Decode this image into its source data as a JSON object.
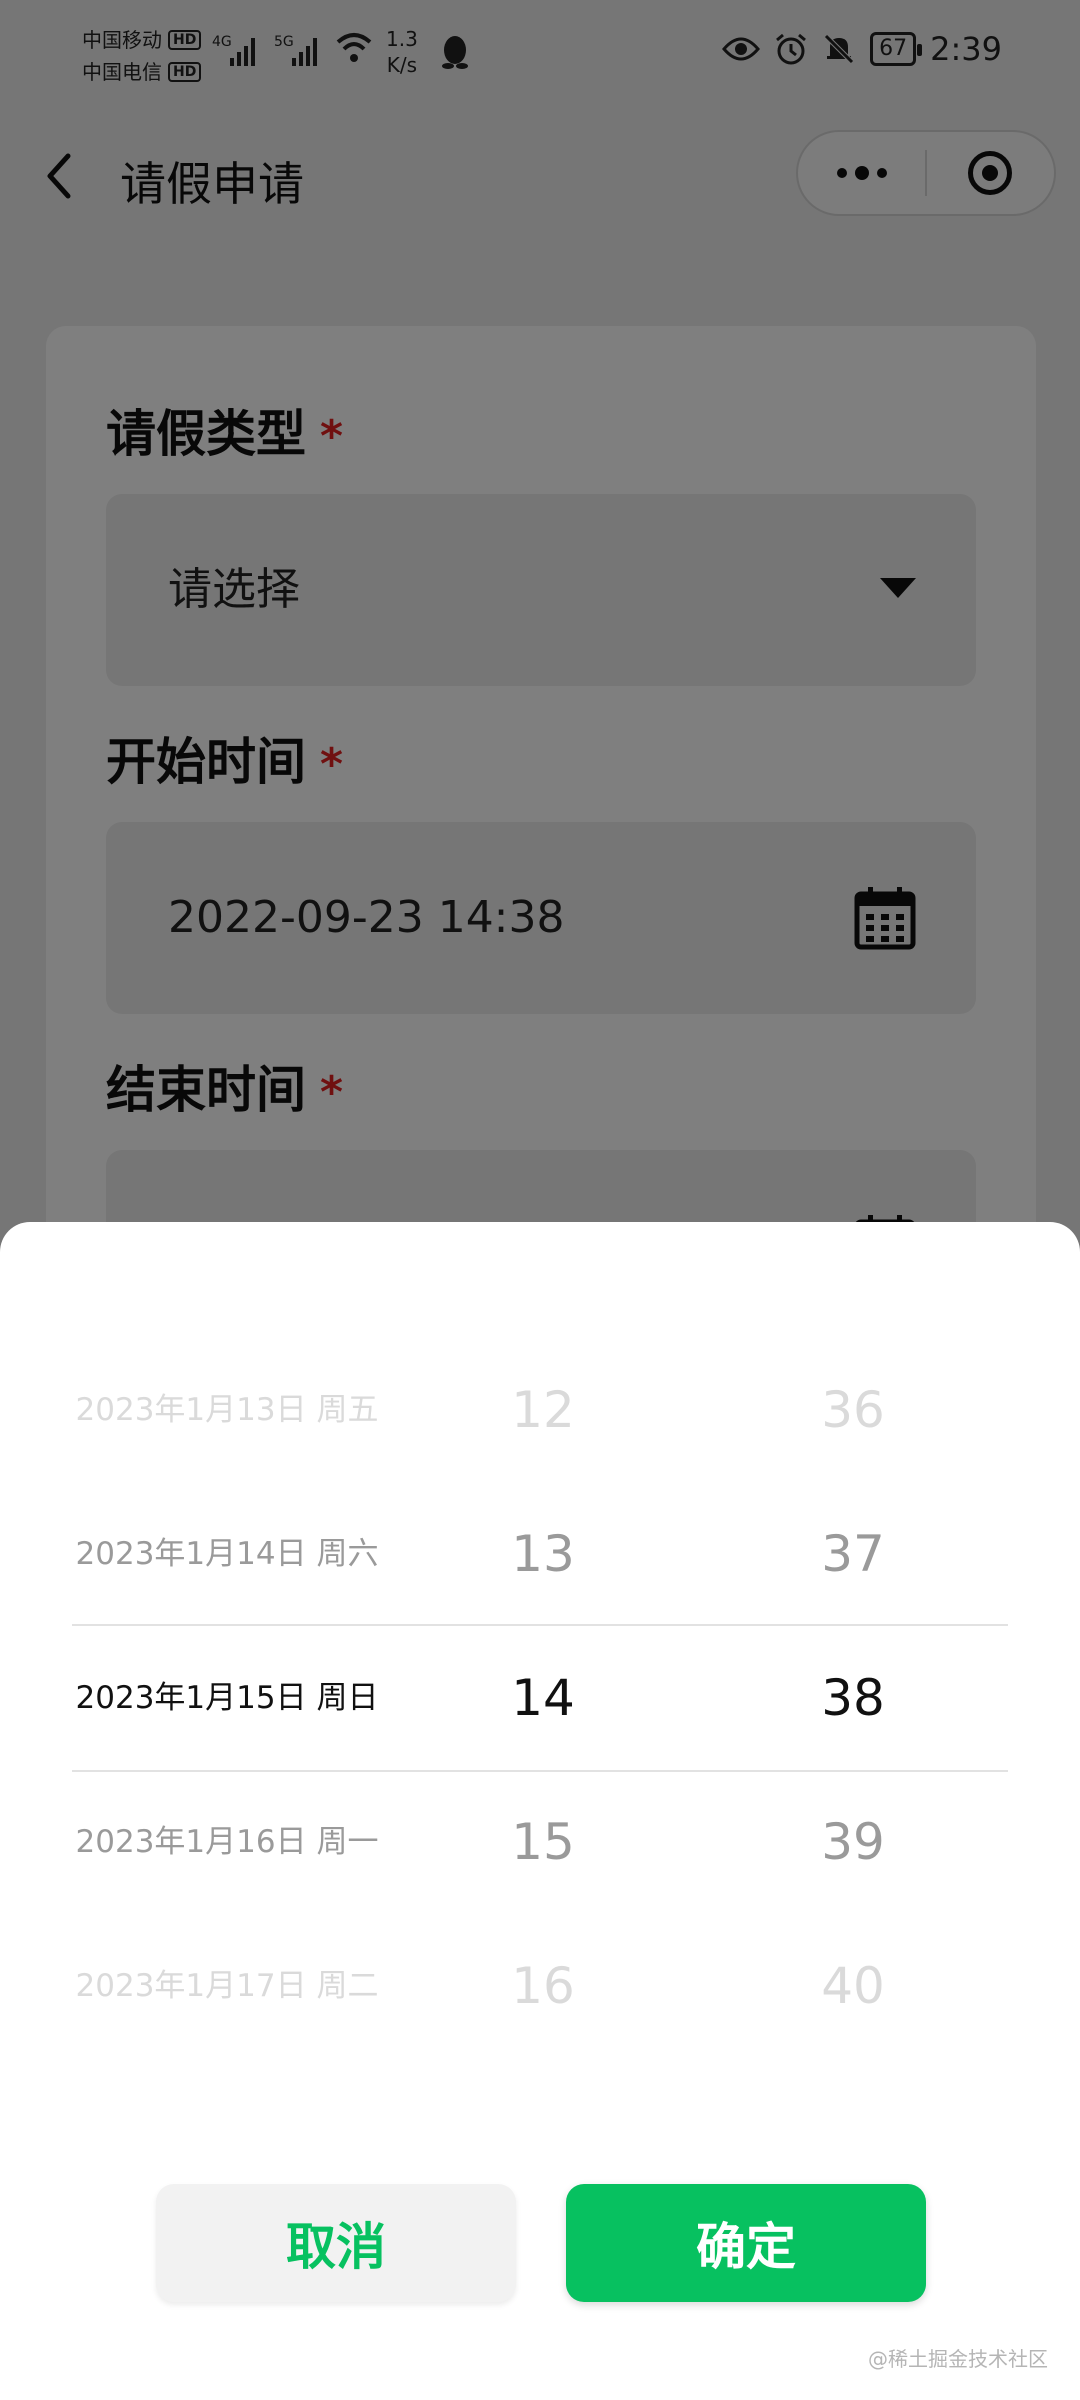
{
  "status_bar": {
    "carrier_1": "中国移动",
    "carrier_2": "中国电信",
    "hd": "HD",
    "net_1": "4G",
    "net_2": "5G",
    "speed_value": "1.3",
    "speed_unit": "K/s",
    "battery": "67",
    "time": "2:39"
  },
  "nav": {
    "title": "请假申请"
  },
  "form": {
    "leave_type_label": "请假类型",
    "leave_type_placeholder": "请选择",
    "start_label": "开始时间",
    "start_value": "2022-09-23 14:38",
    "end_label": "结束时间",
    "required_mark": "*"
  },
  "picker": {
    "rows": [
      {
        "date": "2023年1月13日 周五",
        "hour": "12",
        "minute": "36"
      },
      {
        "date": "2023年1月14日 周六",
        "hour": "13",
        "minute": "37"
      },
      {
        "date": "2023年1月15日 周日",
        "hour": "14",
        "minute": "38"
      },
      {
        "date": "2023年1月16日 周一",
        "hour": "15",
        "minute": "39"
      },
      {
        "date": "2023年1月17日 周二",
        "hour": "16",
        "minute": "40"
      }
    ],
    "cancel_label": "取消",
    "confirm_label": "确定"
  },
  "watermark": "@稀土掘金技术社区",
  "colors": {
    "accent": "#07c160",
    "required": "#e02020",
    "mask": "rgba(0,0,0,0.5)"
  }
}
